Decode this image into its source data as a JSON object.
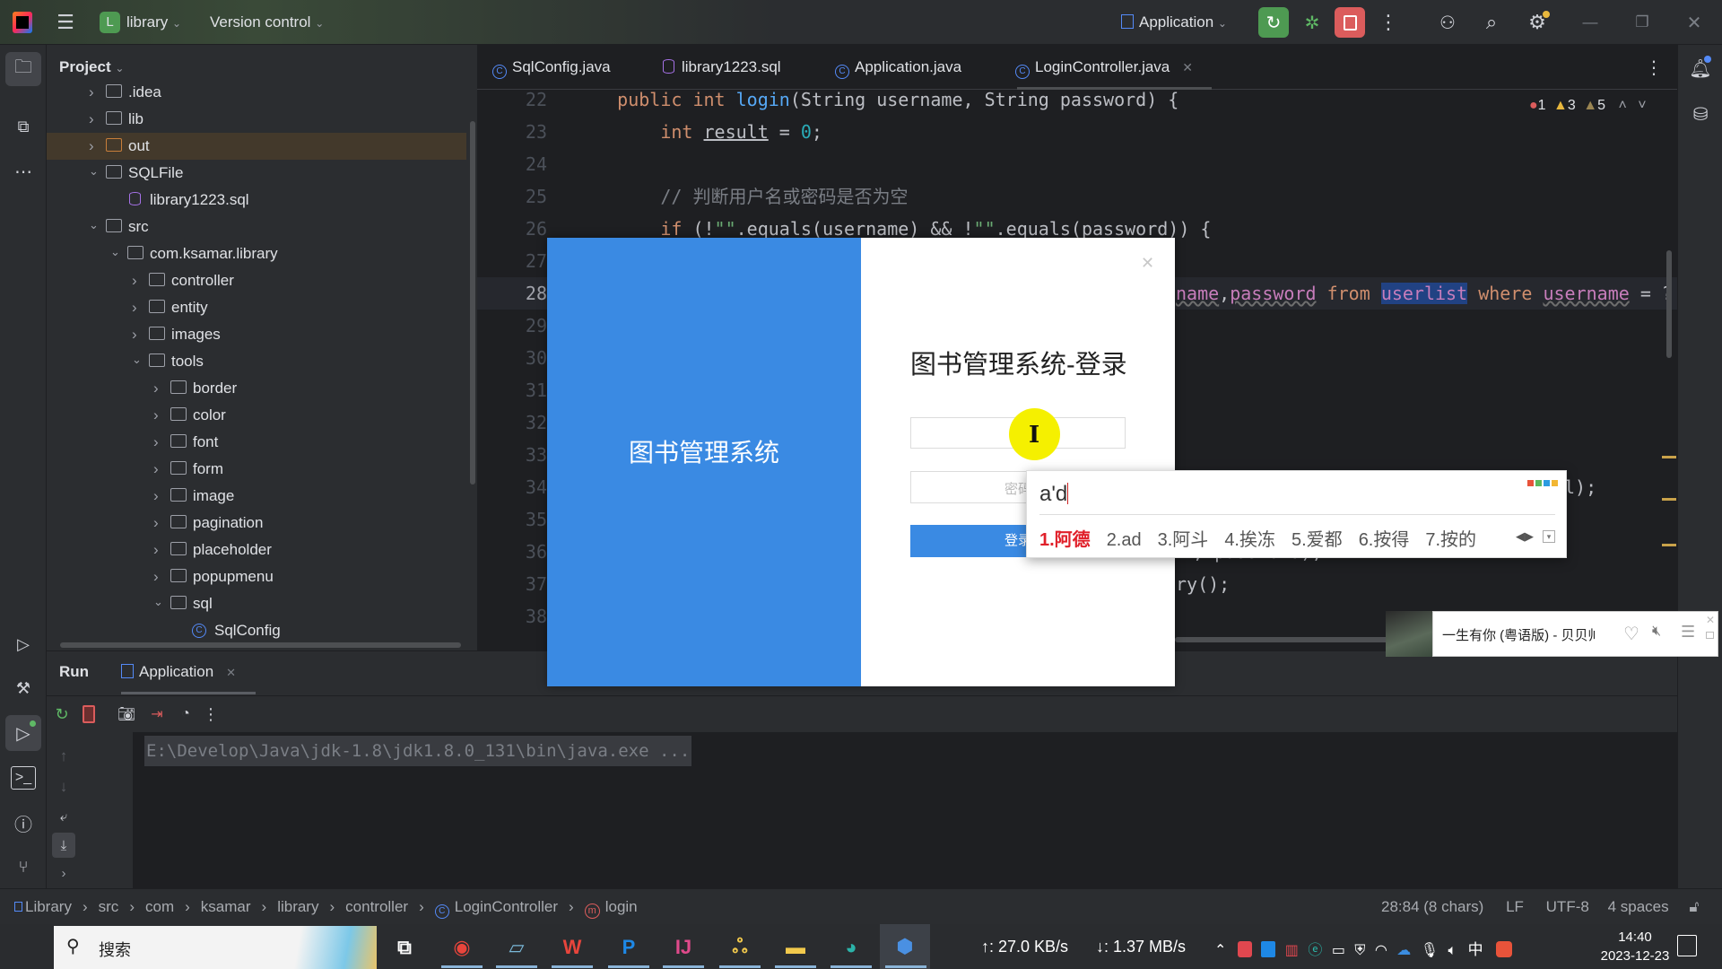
{
  "titlebar": {
    "project_badge": "L",
    "project_name": "library",
    "vcs": "Version control",
    "run_config": "Application",
    "icons": [
      "intellij-logo-icon",
      "hamburger-menu-icon",
      "rerun-icon",
      "debug-bug-icon",
      "stop-icon",
      "more-vert-icon",
      "add-user-icon",
      "search-icon",
      "settings-gear-icon",
      "minimize-icon",
      "restore-icon",
      "close-icon"
    ],
    "colors": {
      "rerun": "#4e9a52",
      "stop": "#db5c5c"
    }
  },
  "project_panel": {
    "title": "Project",
    "tree": [
      {
        "label": ".idea",
        "depth": 1,
        "type": "folder",
        "expanded": false
      },
      {
        "label": "lib",
        "depth": 1,
        "type": "folder",
        "expanded": false
      },
      {
        "label": "out",
        "depth": 1,
        "type": "folder-excluded",
        "expanded": false,
        "selected": true
      },
      {
        "label": "SQLFile",
        "depth": 1,
        "type": "folder",
        "expanded": true
      },
      {
        "label": "library1223.sql",
        "depth": 2,
        "type": "sql-file"
      },
      {
        "label": "src",
        "depth": 1,
        "type": "folder",
        "expanded": true
      },
      {
        "label": "com.ksamar.library",
        "depth": 2,
        "type": "package",
        "expanded": true
      },
      {
        "label": "controller",
        "depth": 3,
        "type": "package",
        "expanded": false
      },
      {
        "label": "entity",
        "depth": 3,
        "type": "package",
        "expanded": false
      },
      {
        "label": "images",
        "depth": 3,
        "type": "package",
        "expanded": false
      },
      {
        "label": "tools",
        "depth": 3,
        "type": "package",
        "expanded": true
      },
      {
        "label": "border",
        "depth": 4,
        "type": "package",
        "expanded": false
      },
      {
        "label": "color",
        "depth": 4,
        "type": "package",
        "expanded": false
      },
      {
        "label": "font",
        "depth": 4,
        "type": "package",
        "expanded": false
      },
      {
        "label": "form",
        "depth": 4,
        "type": "package",
        "expanded": false
      },
      {
        "label": "image",
        "depth": 4,
        "type": "package",
        "expanded": false
      },
      {
        "label": "pagination",
        "depth": 4,
        "type": "package",
        "expanded": false
      },
      {
        "label": "placeholder",
        "depth": 4,
        "type": "package",
        "expanded": false
      },
      {
        "label": "popupmenu",
        "depth": 4,
        "type": "package",
        "expanded": false
      },
      {
        "label": "sql",
        "depth": 4,
        "type": "package",
        "expanded": true
      },
      {
        "label": "SqlConfig",
        "depth": 5,
        "type": "class"
      }
    ]
  },
  "editor": {
    "tabs": [
      {
        "label": "SqlConfig.java",
        "icon": "class-icon",
        "active": false
      },
      {
        "label": "library1223.sql",
        "icon": "database-file-icon",
        "active": false
      },
      {
        "label": "Application.java",
        "icon": "class-icon",
        "active": false
      },
      {
        "label": "LoginController.java",
        "icon": "class-icon",
        "active": true,
        "closable": true
      }
    ],
    "inspections": {
      "errors": "1",
      "warnings": "3",
      "weak_warnings": "5"
    },
    "current_line": 28,
    "lines": [
      {
        "n": 22,
        "segs": [
          [
            "    ",
            ""
          ],
          [
            "public",
            "kw"
          ],
          [
            " ",
            ""
          ],
          [
            "int",
            "kw"
          ],
          [
            " ",
            ""
          ],
          [
            "login",
            "fn"
          ],
          [
            "(String username, String password) {",
            ""
          ]
        ]
      },
      {
        "n": 23,
        "segs": [
          [
            "        ",
            ""
          ],
          [
            "int",
            "kw"
          ],
          [
            " ",
            ""
          ],
          [
            "result",
            "ul"
          ],
          [
            " = ",
            ""
          ],
          [
            "0",
            "num"
          ],
          [
            ";",
            ""
          ]
        ]
      },
      {
        "n": 24,
        "segs": []
      },
      {
        "n": 25,
        "segs": [
          [
            "        ",
            ""
          ],
          [
            "// 判断用户名或密码是否为空",
            "cm"
          ]
        ]
      },
      {
        "n": 26,
        "segs": [
          [
            "        ",
            ""
          ],
          [
            "if",
            "kw"
          ],
          [
            " (!",
            ""
          ],
          [
            "\"\"",
            "str"
          ],
          [
            ".equals(username) && !",
            ""
          ],
          [
            "\"\"",
            "str"
          ],
          [
            ".equals(password)) {",
            ""
          ]
        ]
      },
      {
        "n": 27,
        "segs": []
      },
      {
        "n": 28,
        "frag": true,
        "segs": [
          [
            "name",
            "id wavy"
          ],
          [
            ",",
            ""
          ],
          [
            "password",
            "id wavy"
          ],
          [
            " ",
            ""
          ],
          [
            "from",
            "sqlkw"
          ],
          [
            " ",
            ""
          ],
          [
            "userlist",
            "id sel"
          ],
          [
            " ",
            ""
          ],
          [
            "where",
            "sqlkw"
          ],
          [
            " ",
            ""
          ],
          [
            "username",
            "id wavy"
          ],
          [
            " = ?",
            ""
          ]
        ]
      },
      {
        "n": 29,
        "segs": []
      },
      {
        "n": 30,
        "segs": []
      },
      {
        "n": 31,
        "segs": []
      },
      {
        "n": 32,
        "segs": []
      },
      {
        "n": 33,
        "segs": []
      },
      {
        "n": 34,
        "frag2": true,
        "segs": [
          [
            "l);",
            ""
          ]
        ]
      },
      {
        "n": 35,
        "segs": []
      },
      {
        "n": 36,
        "frag3": true,
        "segs": [
          [
            ", password);",
            ""
          ]
        ]
      },
      {
        "n": 37,
        "frag": true,
        "segs": [
          [
            "ry();",
            ""
          ]
        ]
      },
      {
        "n": 38,
        "segs": []
      }
    ]
  },
  "run_panel": {
    "title": "Run",
    "tab": "Application",
    "console_line": "E:\\Develop\\Java\\jdk-1.8\\jdk1.8.0_131\\bin\\java.exe ..."
  },
  "statusbar": {
    "breadcrumb": [
      "Library",
      "src",
      "com",
      "ksamar",
      "library",
      "controller",
      "LoginController",
      "login"
    ],
    "position": "28:84 (8 chars)",
    "line_sep": "LF",
    "encoding": "UTF-8",
    "indent": "4 spaces"
  },
  "dialog": {
    "side_title": "图书管理系统",
    "title": "图书管理系统-登录",
    "username_value": "",
    "password_placeholder": "密码",
    "login_button": "登录",
    "accent": "#3a8ae3"
  },
  "ime": {
    "composition": "a'd",
    "candidates": [
      "1.阿德",
      "2.ad",
      "3.阿斗",
      "4.挨冻",
      "5.爱都",
      "6.按得",
      "7.按的"
    ]
  },
  "music": {
    "track": "一生有你 (粤语版) - 贝贝帅"
  },
  "taskbar": {
    "search_placeholder": "搜索",
    "upload": "↑: 27.0 KB/s",
    "download": "↓: 1.37 MB/s",
    "ime_lang": "中",
    "time": "14:40",
    "date": "2023-12-23",
    "apps": [
      "task-view-icon",
      "chrome-icon",
      "notepad-icon",
      "wps-icon",
      "p-app-icon",
      "intellij-icon",
      "navicat-icon",
      "file-explorer-icon",
      "edge-icon",
      "java-app-icon"
    ]
  }
}
